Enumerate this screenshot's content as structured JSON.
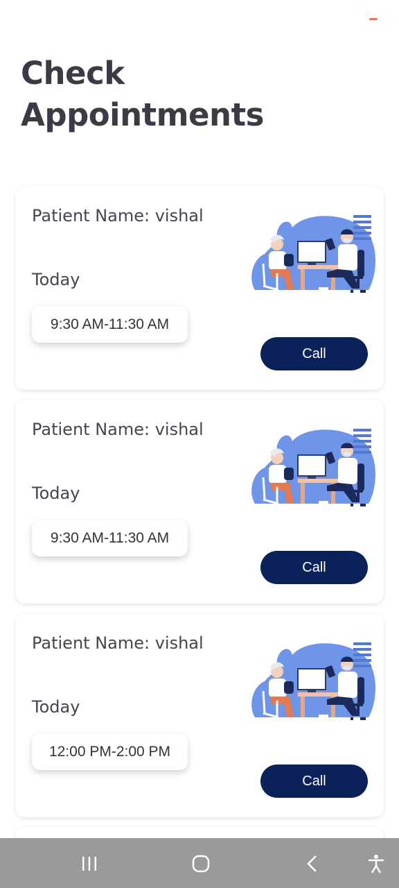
{
  "page": {
    "title": "Check Appointments"
  },
  "appointments": [
    {
      "patient_label": "Patient Name: vishal",
      "day": "Today",
      "time": "9:30 AM-11:30 AM",
      "call_label": "Call"
    },
    {
      "patient_label": "Patient Name: vishal",
      "day": "Today",
      "time": "9:30 AM-11:30 AM",
      "call_label": "Call"
    },
    {
      "patient_label": "Patient Name: vishal",
      "day": "Today",
      "time": "12:00 PM-2:00 PM",
      "call_label": "Call"
    }
  ],
  "icons": {
    "illustration": "doctor-patient-illustration",
    "nav_recents": "recents-icon",
    "nav_home": "home-icon",
    "nav_back": "back-icon",
    "nav_accessibility": "accessibility-icon"
  },
  "colors": {
    "accent": "#e8794e",
    "button": "#0a2259",
    "title": "#3b3a45",
    "illustration_blue": "#6f95e8",
    "nav_bar": "#9a9a9a"
  }
}
